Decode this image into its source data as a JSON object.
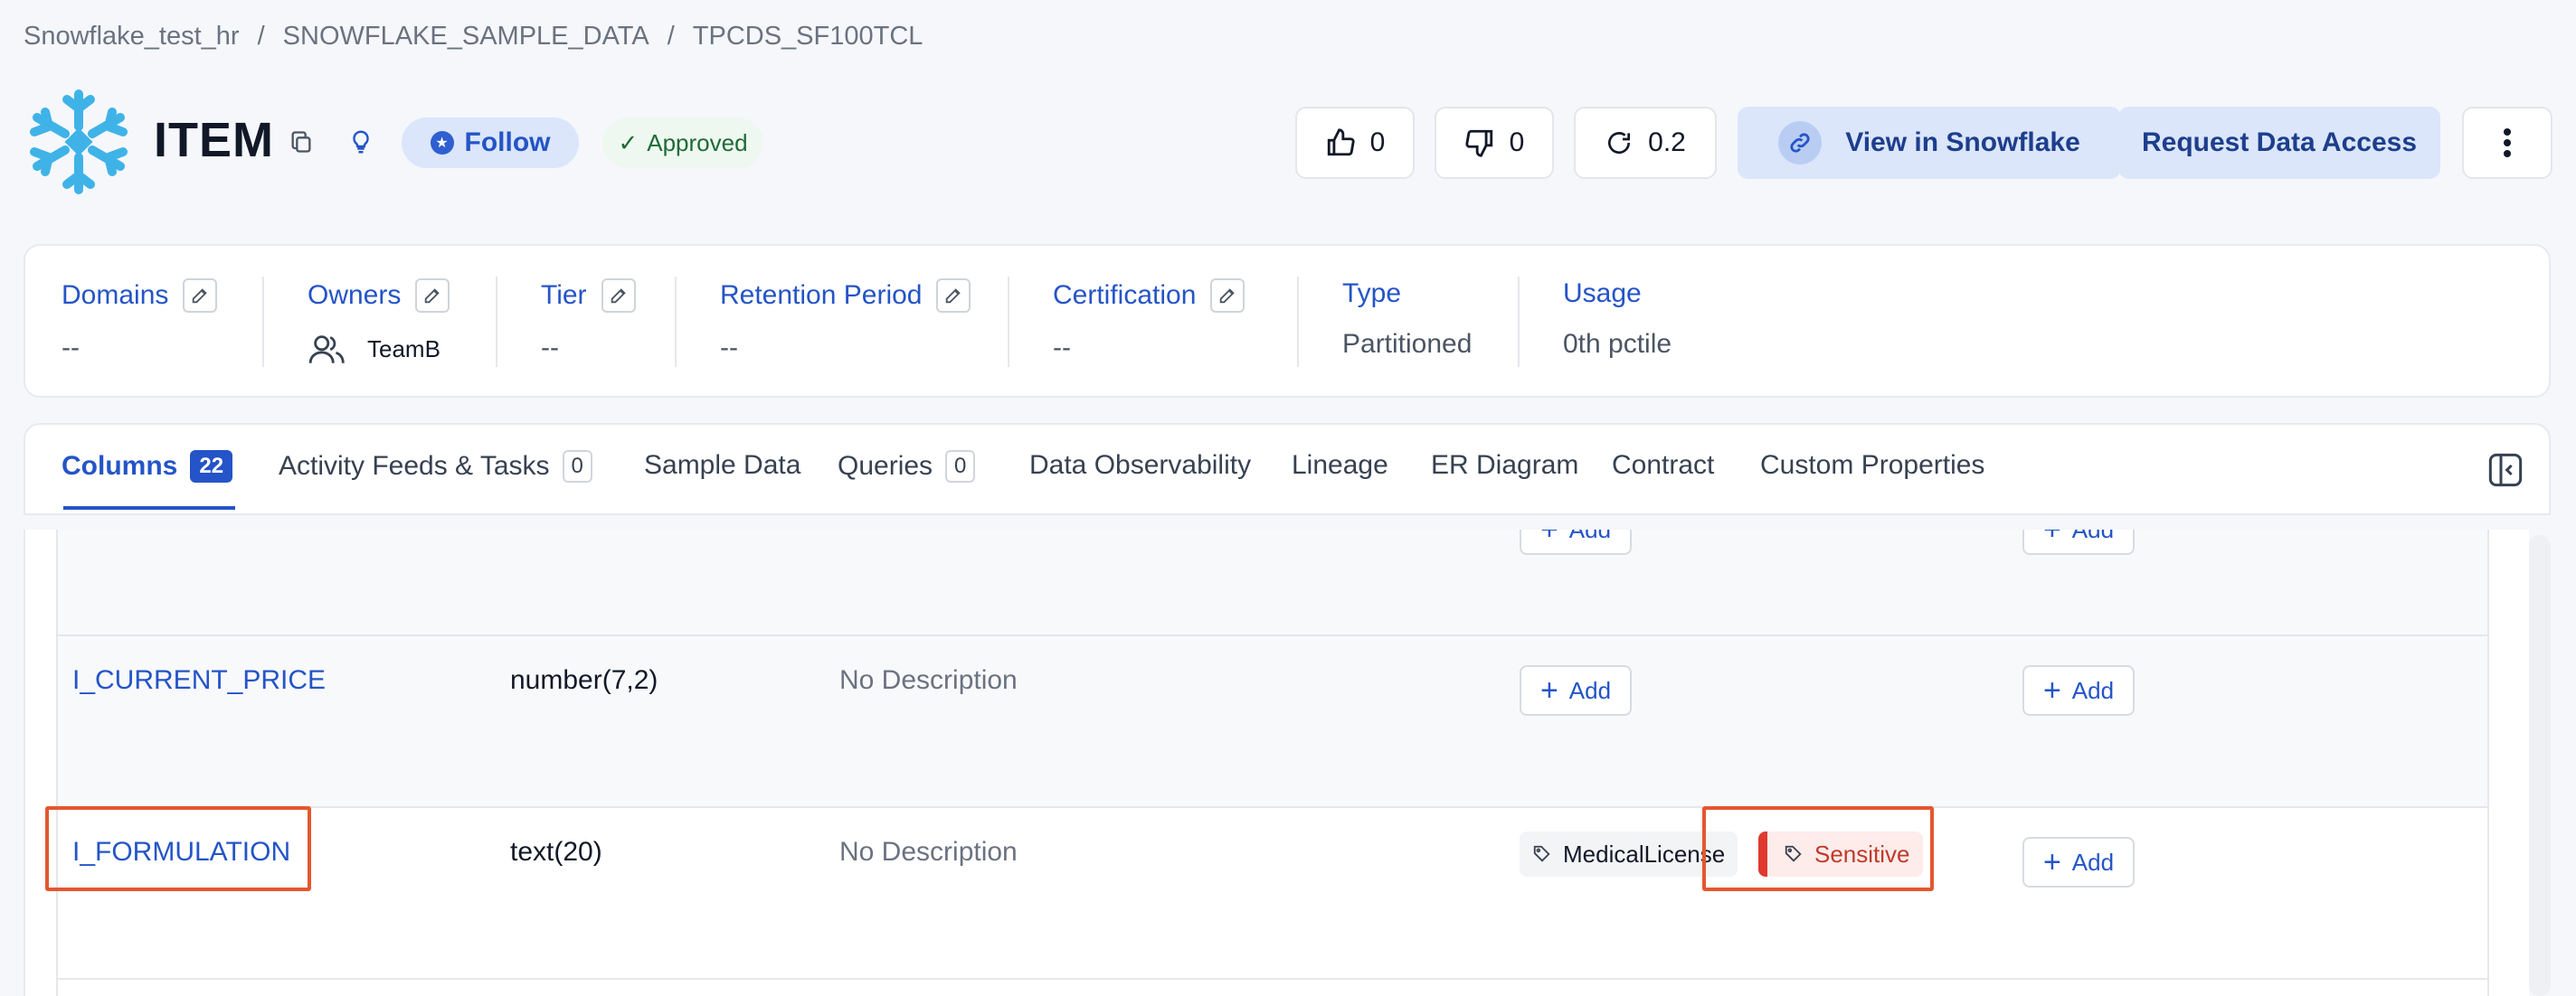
{
  "breadcrumb": {
    "items": [
      "Snowflake_test_hr",
      "SNOWFLAKE_SAMPLE_DATA",
      "TPCDS_SF100TCL"
    ],
    "separator": "/"
  },
  "header": {
    "title": "ITEM",
    "follow_label": "Follow",
    "approved_label": "Approved",
    "likes": "0",
    "dislikes": "0",
    "version": "0.2",
    "view_label": "View in Snowflake",
    "request_label": "Request Data Access"
  },
  "properties": {
    "domains": {
      "label": "Domains",
      "value": "--"
    },
    "owners": {
      "label": "Owners",
      "value": "TeamB"
    },
    "tier": {
      "label": "Tier",
      "value": "--"
    },
    "retention": {
      "label": "Retention Period",
      "value": "--"
    },
    "certification": {
      "label": "Certification",
      "value": "--"
    },
    "type": {
      "label": "Type",
      "value": "Partitioned"
    },
    "usage": {
      "label": "Usage",
      "value": "0th pctile"
    }
  },
  "tabs": [
    {
      "label": "Columns",
      "count": "22"
    },
    {
      "label": "Activity Feeds & Tasks",
      "count": "0"
    },
    {
      "label": "Sample Data"
    },
    {
      "label": "Queries",
      "count": "0"
    },
    {
      "label": "Data Observability"
    },
    {
      "label": "Lineage"
    },
    {
      "label": "ER Diagram"
    },
    {
      "label": "Contract"
    },
    {
      "label": "Custom Properties"
    }
  ],
  "columns": {
    "add_label": "Add",
    "rows": [
      {
        "name": "I_CURRENT_PRICE",
        "type": "number(7,2)",
        "description": "No Description"
      },
      {
        "name": "I_FORMULATION",
        "type": "text(20)",
        "description": "No Description",
        "tags": [
          "MedicalLicense",
          "Sensitive"
        ]
      }
    ]
  },
  "colors": {
    "accent": "#2454c7",
    "highlight": "#e4572e",
    "sensitive": "#e03a2f",
    "logo": "#3fb3e8"
  }
}
